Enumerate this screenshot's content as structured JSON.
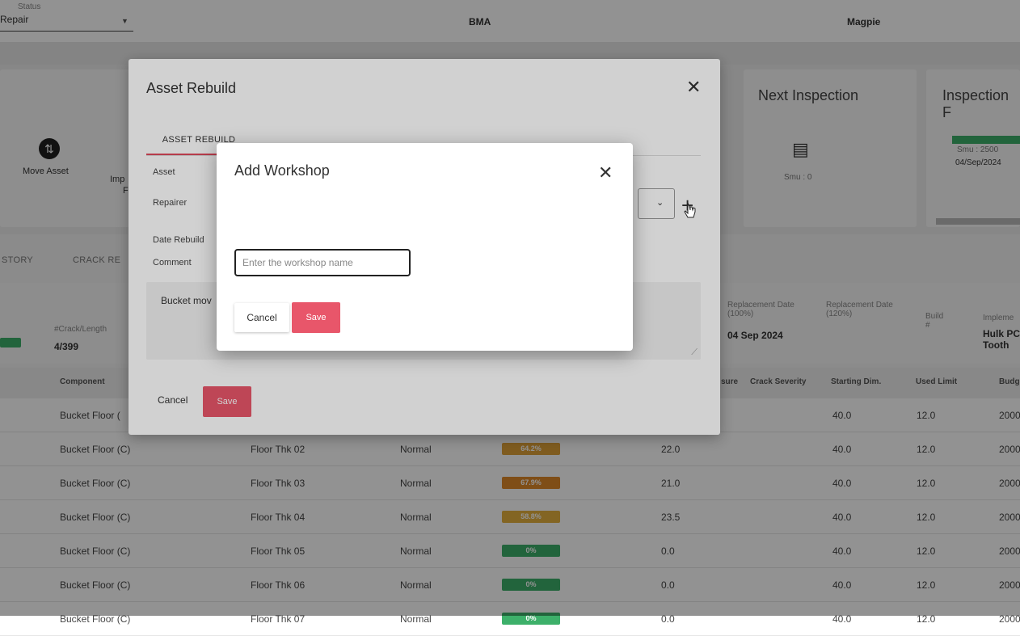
{
  "header": {
    "status_label": "Status",
    "status_value": "Repair",
    "site_value": "BMA",
    "asset_value": "Magpie"
  },
  "actions": {
    "move_asset": "Move Asset",
    "partial_label_1": "Imp",
    "partial_label_2": "F"
  },
  "cards": {
    "next_inspection_title": "Next Inspection",
    "next_inspection_smu": "Smu : 0",
    "inspection_title": "Inspection F",
    "inspection_badge": "",
    "inspection_smu": "Smu : 2500",
    "inspection_date": "04/Sep/2024"
  },
  "tabs": [
    "STORY",
    "CRACK RE"
  ],
  "info": {
    "crack_label": "#Crack/Length",
    "crack_value": "4/399",
    "replacement_100_label": "Replacement Date (100%)",
    "replacement_100_value": "04 Sep 2024",
    "replacement_120_label": "Replacement Date (120%)",
    "build_label": "Build #",
    "implement_label": "Impleme",
    "implement_value": "Hulk PC Tooth"
  },
  "table": {
    "headers": {
      "component": "Component",
      "crack_severity": "Crack Severity",
      "measure": "sure",
      "starting_dim": "Starting Dim.",
      "used_limit": "Used Limit",
      "budget": "Budg"
    },
    "rows": [
      {
        "component": "Bucket Floor (",
        "location": "",
        "status": "",
        "pct": "",
        "pct_color": "",
        "value": "",
        "start": "40.0",
        "limit": "12.0",
        "budget": "2000"
      },
      {
        "component": "Bucket Floor (C)",
        "location": "Floor Thk 02",
        "status": "Normal",
        "pct": "64.2%",
        "pct_color": "#e0a23a",
        "value": "22.0",
        "start": "40.0",
        "limit": "12.0",
        "budget": "2000"
      },
      {
        "component": "Bucket Floor (C)",
        "location": "Floor Thk 03",
        "status": "Normal",
        "pct": "67.9%",
        "pct_color": "#e08a2a",
        "value": "21.0",
        "start": "40.0",
        "limit": "12.0",
        "budget": "2000"
      },
      {
        "component": "Bucket Floor (C)",
        "location": "Floor Thk 04",
        "status": "Normal",
        "pct": "58.8%",
        "pct_color": "#e6b23e",
        "value": "23.5",
        "start": "40.0",
        "limit": "12.0",
        "budget": "2000"
      },
      {
        "component": "Bucket Floor (C)",
        "location": "Floor Thk 05",
        "status": "Normal",
        "pct": "0%",
        "pct_color": "#3db06a",
        "value": "0.0",
        "start": "40.0",
        "limit": "12.0",
        "budget": "2000"
      },
      {
        "component": "Bucket Floor (C)",
        "location": "Floor Thk 06",
        "status": "Normal",
        "pct": "0%",
        "pct_color": "#3db06a",
        "value": "0.0",
        "start": "40.0",
        "limit": "12.0",
        "budget": "2000"
      },
      {
        "component": "Bucket Floor (C)",
        "location": "Floor Thk 07",
        "status": "Normal",
        "pct": "0%",
        "pct_color": "#3db06a",
        "value": "0.0",
        "start": "40.0",
        "limit": "12.0",
        "budget": "2000"
      }
    ]
  },
  "asset_rebuild_modal": {
    "title": "Asset Rebuild",
    "tab": "ASSET REBUILD",
    "fields": {
      "asset": "Asset",
      "repairer": "Repairer",
      "date_rebuild": "Date Rebuild",
      "comment": "Comment"
    },
    "comment_value": "Bucket mov",
    "cancel": "Cancel",
    "save": "Save"
  },
  "add_workshop_modal": {
    "title": "Add Workshop",
    "input_placeholder": "Enter the workshop name",
    "cancel": "Cancel",
    "save": "Save"
  },
  "colors": {
    "accent": "#e8566a",
    "green": "#3db06a"
  }
}
